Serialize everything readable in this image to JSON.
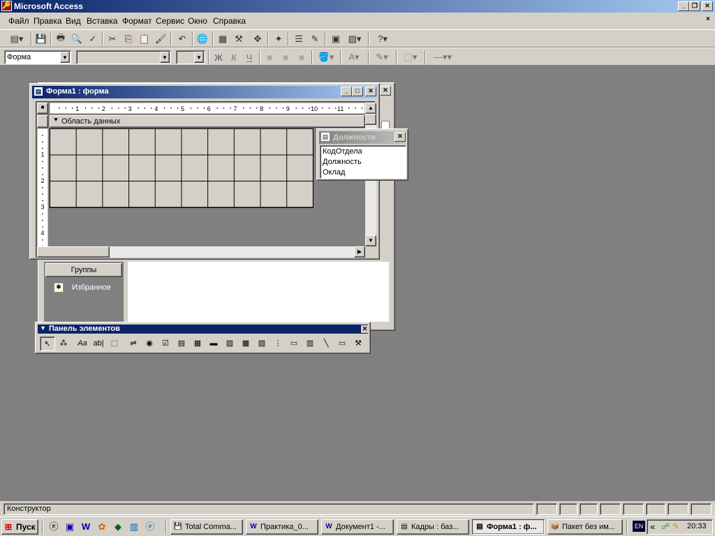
{
  "app": {
    "title": "Microsoft Access",
    "icon": "access-key-icon"
  },
  "menu": [
    "Файл",
    "Правка",
    "Вид",
    "Вставка",
    "Формат",
    "Сервис",
    "Окно",
    "Справка"
  ],
  "format_toolbar": {
    "object_combo": "Форма",
    "font_combo": "",
    "size_combo": "",
    "bold": "Ж",
    "italic": "К",
    "underline": "Ч"
  },
  "form_window": {
    "title": "Форма1 : форма",
    "section_label": "Область данных",
    "ruler_top": [
      "1",
      "2",
      "3",
      "4",
      "5",
      "6",
      "7",
      "8",
      "9",
      "10",
      "11"
    ],
    "ruler_left": [
      "1",
      "2",
      "3",
      "4"
    ]
  },
  "field_list": {
    "title": "Должности",
    "fields": [
      "КодОтдела",
      "Должность",
      "Оклад"
    ]
  },
  "db_window": {
    "groups_label": "Группы",
    "favorites_label": "Избранное"
  },
  "toolbox": {
    "title": "Панель элементов",
    "tools": [
      "pointer-icon",
      "wizard-icon",
      "label-icon",
      "textbox-icon",
      "option-group-icon",
      "toggle-button-icon",
      "option-button-icon",
      "checkbox-icon",
      "combobox-icon",
      "listbox-icon",
      "command-button-icon",
      "image-icon",
      "unbound-object-icon",
      "bound-object-icon",
      "page-break-icon",
      "tab-control-icon",
      "subform-icon",
      "line-icon",
      "rectangle-icon",
      "more-controls-icon"
    ]
  },
  "status": {
    "text": "Конструктор"
  },
  "taskbar": {
    "start": "Пуск",
    "tasks": [
      {
        "label": "Total Comma...",
        "icon": "total-commander-icon"
      },
      {
        "label": "Практика_0...",
        "icon": "word-icon"
      },
      {
        "label": "Документ1 -...",
        "icon": "word-icon"
      },
      {
        "label": "Кадры : баз...",
        "icon": "database-icon"
      },
      {
        "label": "Форма1 : ф...",
        "icon": "form-icon",
        "active": true
      },
      {
        "label": "Пакет без им...",
        "icon": "package-icon"
      }
    ],
    "lang": "EN",
    "clock": "20:33"
  }
}
